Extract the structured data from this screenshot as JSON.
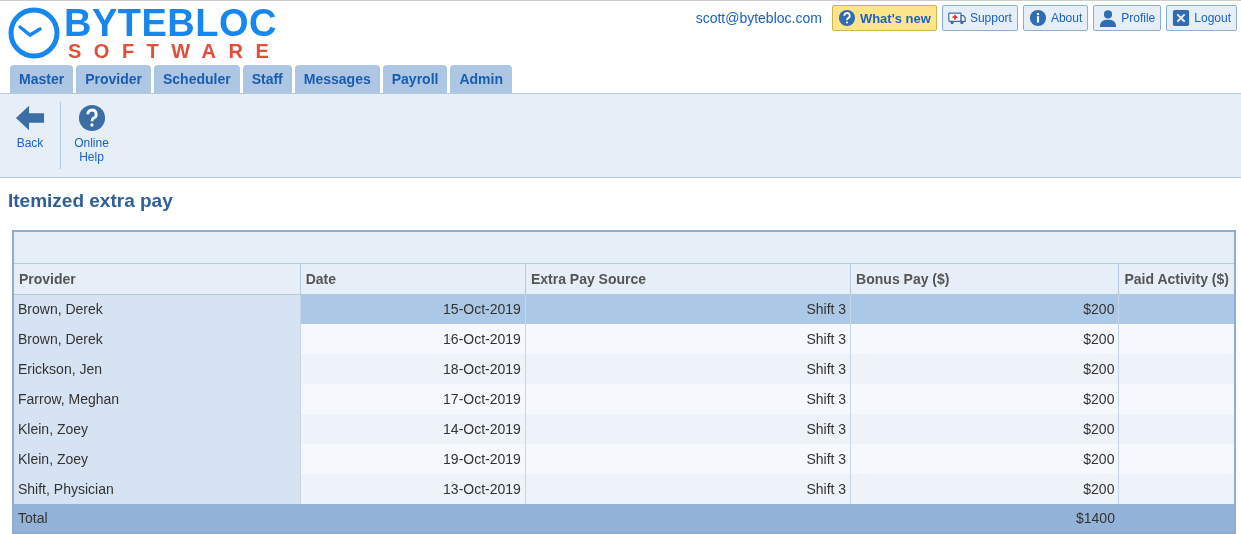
{
  "logo": {
    "name": "BYTEBLOC",
    "tagline": "SOFTWARE"
  },
  "user": {
    "email": "scott@bytebloc.com"
  },
  "header_buttons": [
    {
      "label": "What's new",
      "kind": "whatsnew"
    },
    {
      "label": "Support",
      "kind": "support"
    },
    {
      "label": "About",
      "kind": "about"
    },
    {
      "label": "Profile",
      "kind": "profile"
    },
    {
      "label": "Logout",
      "kind": "logout"
    }
  ],
  "tabs": [
    {
      "label": "Master",
      "selected": false
    },
    {
      "label": "Provider",
      "selected": false
    },
    {
      "label": "Scheduler",
      "selected": false
    },
    {
      "label": "Staff",
      "selected": false
    },
    {
      "label": "Messages",
      "selected": false
    },
    {
      "label": "Payroll",
      "selected": false
    },
    {
      "label": "Admin",
      "selected": false
    }
  ],
  "toolbar": [
    {
      "label": "Back",
      "kind": "back"
    },
    {
      "label": "Online Help",
      "kind": "help"
    }
  ],
  "page_title": "Itemized extra pay",
  "table": {
    "columns": [
      "Provider",
      "Date",
      "Extra Pay Source",
      "Bonus Pay ($)",
      "Paid Activity ($)"
    ],
    "rows": [
      {
        "cells": [
          "Brown, Derek",
          "15-Oct-2019",
          "Shift 3",
          "$200",
          ""
        ],
        "selected": true
      },
      {
        "cells": [
          "Brown, Derek",
          "16-Oct-2019",
          "Shift 3",
          "$200",
          ""
        ],
        "selected": false
      },
      {
        "cells": [
          "Erickson, Jen",
          "18-Oct-2019",
          "Shift 3",
          "$200",
          ""
        ],
        "selected": false
      },
      {
        "cells": [
          "Farrow, Meghan",
          "17-Oct-2019",
          "Shift 3",
          "$200",
          ""
        ],
        "selected": false
      },
      {
        "cells": [
          "Klein, Zoey",
          "14-Oct-2019",
          "Shift 3",
          "$200",
          ""
        ],
        "selected": false
      },
      {
        "cells": [
          "Klein, Zoey",
          "19-Oct-2019",
          "Shift 3",
          "$200",
          ""
        ],
        "selected": false
      },
      {
        "cells": [
          "Shift, Physician",
          "13-Oct-2019",
          "Shift 3",
          "$200",
          ""
        ],
        "selected": false
      }
    ],
    "total": {
      "label": "Total",
      "bonus": "$1400"
    }
  }
}
